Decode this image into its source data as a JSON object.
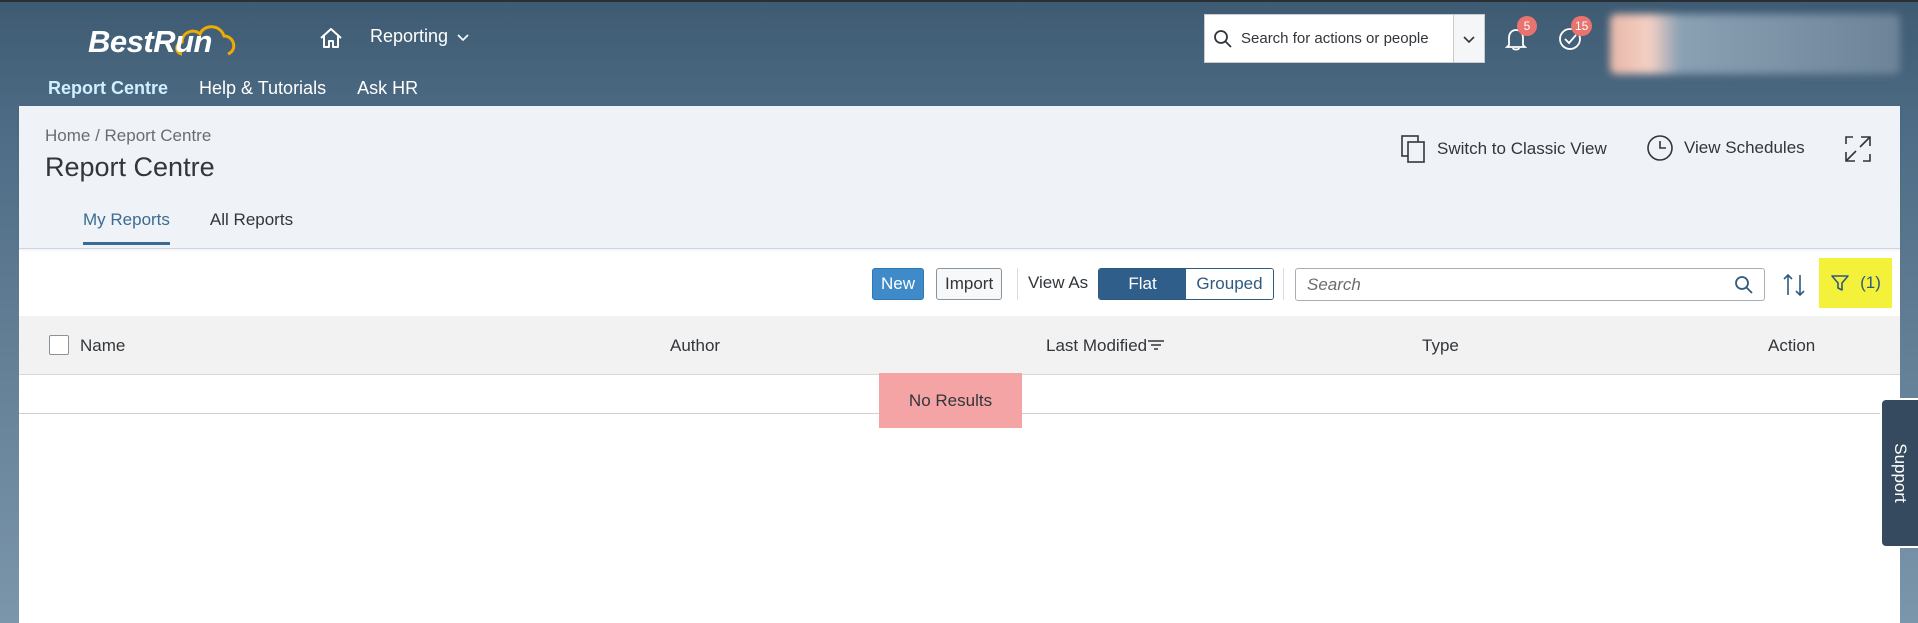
{
  "header": {
    "logo_text": "BestRun",
    "module_menu_label": "Reporting",
    "nav_links": [
      "Report Centre",
      "Help & Tutorials",
      "Ask HR"
    ],
    "search_placeholder": "Search for actions or people",
    "notification_count": "5",
    "todo_count": "15"
  },
  "page": {
    "breadcrumb": "Home / Report Centre",
    "title": "Report Centre",
    "actions": {
      "classic_view": "Switch to Classic View",
      "schedules": "View Schedules"
    },
    "tabs": [
      "My Reports",
      "All Reports"
    ]
  },
  "toolbar": {
    "new_label": "New",
    "import_label": "Import",
    "view_as_label": "View As",
    "view_options": [
      "Flat",
      "Grouped"
    ],
    "selected_view": "Flat",
    "search_placeholder": "Search",
    "filter_label": "(1)"
  },
  "table": {
    "columns": [
      "Name",
      "Author",
      "Last Modified",
      "Type",
      "Action"
    ],
    "empty_message": "No Results"
  },
  "support_label": "Support",
  "colors": {
    "accent": "#3b6b92",
    "highlight_filter": "#f4f13a",
    "highlight_empty": "#f4a4a4",
    "badge": "#e9736e"
  }
}
